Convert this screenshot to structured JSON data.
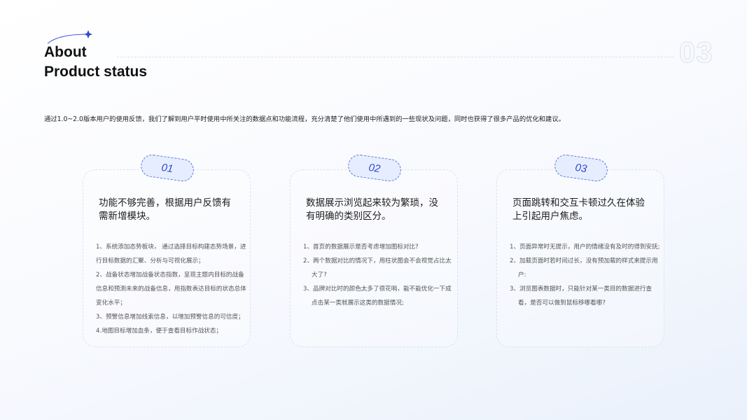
{
  "header": {
    "title_line1": "About",
    "title_line2": "Product status",
    "page_number": "03"
  },
  "intro": "通过1.0~2.0版本用户的使用反馈，我们了解到用户平时使用中所关注的数据点和功能流程，充分清楚了他们使用中所遇到的一些现状及问题，同时也获得了很多产品的优化和建议。",
  "cards": [
    {
      "badge": "01",
      "title": "功能不够完善，根据用户反馈有需新增模块。",
      "items": [
        "1、系统添加态势板块， 通过选择目标构建态势场景，进行目标数据的汇聚、分析与可视化展示；",
        "2、战备状态增加战备状态指数，呈现主题内目标的战备信息和预测未来的战备信息，用指数表达目标的状态总体变化水平；",
        "3、预警信息增加线索信息，以增加预警信息的可信度；",
        "4.地图目标增加血条，便于查看目标作战状态；"
      ]
    },
    {
      "badge": "02",
      "title": "数据展示浏览起来较为繁琐，没有明确的类别区分。",
      "items": [
        "1、首页的数据展示是否考虑增加图标对比?",
        "2、两个数据对比的情况下，用柱状图会不会视觉占比太大了?",
        "3、品牌对比时的颜色太多了很花哨，能不能优化一下成点击某一类就展示这类的数据情况;"
      ]
    },
    {
      "badge": "03",
      "title": "页面跳转和交互卡顿过久在体验上引起用户焦虑。",
      "items": [
        "1、页面异常时无提示，用户的情绪没有及时的得到安抚;",
        "2、加载页面时若时间过长，没有预加载的样式来提示用户:",
        "3、浏览图表数据时，只能针对某一类目的数据进行查看，是否可以做到鼠标移哪看哪?"
      ]
    }
  ],
  "colors": {
    "accent": "#2f49c9",
    "badge_fill": "#e6edff",
    "badge_border": "#5a73d8",
    "card_border": "#dbe2ee"
  }
}
